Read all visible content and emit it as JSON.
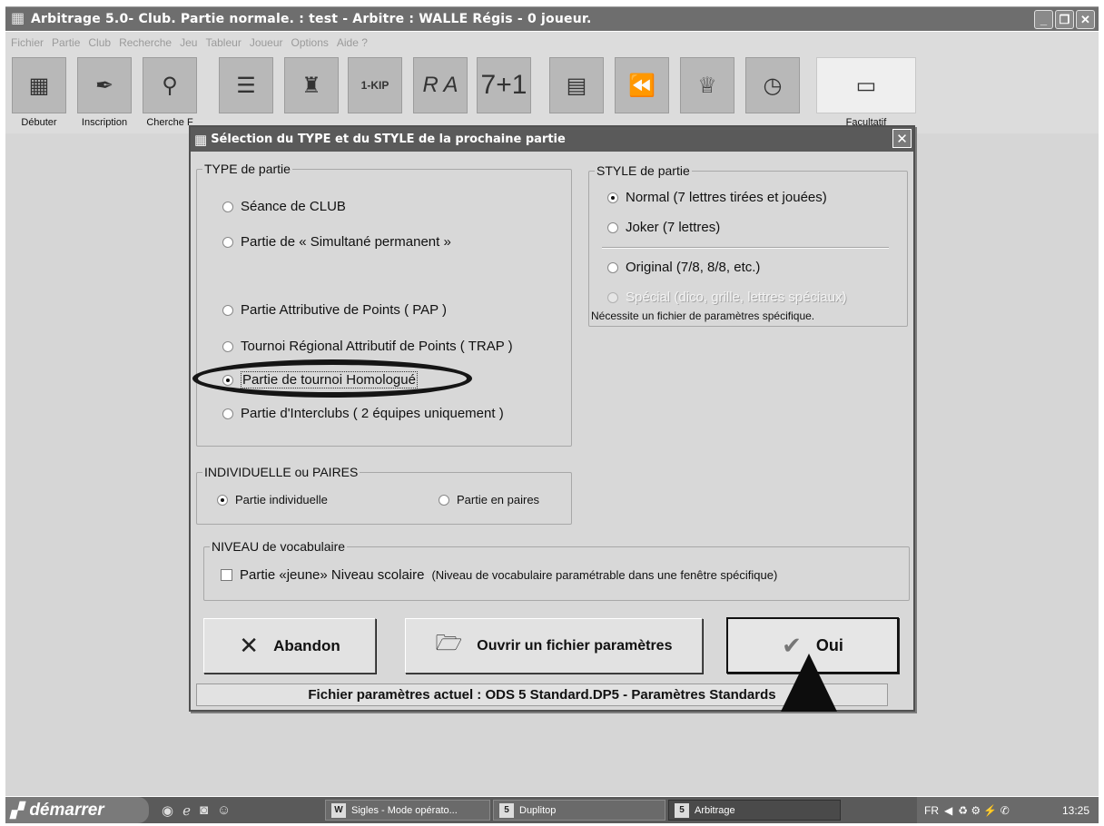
{
  "window": {
    "title": "Arbitrage 5.0- Club. Partie normale. : test - Arbitre : WALLE Régis - 0 joueur.",
    "buttons": [
      "_",
      "❐",
      "✕"
    ]
  },
  "menu": [
    "Fichier",
    "Partie",
    "Club",
    "Recherche",
    "Jeu",
    "Tableur",
    "Joueur",
    "Options",
    "Aide ?"
  ],
  "toolbar": {
    "items": [
      {
        "label": "Débuter",
        "icon": "board-icon"
      },
      {
        "label": "Inscription",
        "icon": "quill-icon"
      },
      {
        "label": "Cherche F",
        "icon": "magnifier-icon"
      },
      {
        "label": "",
        "icon": "document-icon"
      },
      {
        "label": "",
        "icon": "bag-icon"
      },
      {
        "label": "",
        "icon": "list-icon"
      },
      {
        "label": "",
        "icon": "letters-icon"
      },
      {
        "label": "",
        "icon": "plus-one-icon"
      },
      {
        "label": "",
        "icon": "dictionary-icon"
      },
      {
        "label": "",
        "icon": "rewind-icon"
      },
      {
        "label": "",
        "icon": "trophy-icon"
      },
      {
        "label": "",
        "icon": "clock-icon"
      },
      {
        "label": "Facultatif",
        "icon": "usb-key-icon"
      }
    ]
  },
  "dialog": {
    "title": "Sélection du TYPE et du STYLE de la prochaine partie",
    "type_group": {
      "legend": "TYPE de partie",
      "options": [
        {
          "label": "Séance de CLUB",
          "selected": false
        },
        {
          "label": "Partie de « Simultané permanent »",
          "selected": false
        },
        {
          "label": "Partie Attributive de Points ( PAP )",
          "selected": false
        },
        {
          "label": "Tournoi Régional Attributif de Points ( TRAP )",
          "selected": false
        },
        {
          "label": "Partie de tournoi Homologué",
          "selected": true
        },
        {
          "label": "Partie d'Interclubs ( 2 équipes uniquement )",
          "selected": false
        }
      ]
    },
    "style_group": {
      "legend": "STYLE de partie",
      "options": [
        {
          "label": "Normal (7 lettres tirées et jouées)",
          "selected": true
        },
        {
          "label": "Joker (7 lettres)",
          "selected": false
        },
        {
          "label": "Original (7/8, 8/8, etc.)",
          "selected": false
        },
        {
          "label": "Spécial (dico, grille, lettres spéciaux)",
          "selected": false,
          "disabled": true
        }
      ],
      "note": "Nécessite un fichier de paramètres spécifique."
    },
    "mode_group": {
      "legend": "INDIVIDUELLE ou PAIRES",
      "options": [
        {
          "label": "Partie individuelle",
          "selected": true
        },
        {
          "label": "Partie en paires",
          "selected": false
        }
      ]
    },
    "level_group": {
      "legend": "NIVEAU de vocabulaire",
      "checkbox_label": "Partie «jeune» Niveau scolaire",
      "checkbox_note": "(Niveau de vocabulaire paramétrable dans une fenêtre spécifique)",
      "checked": false
    },
    "buttons": {
      "cancel": "Abandon",
      "open": "Ouvrir un fichier paramètres",
      "ok": "Oui"
    },
    "status": "Fichier paramètres actuel : ODS 5 Standard.DP5 - Paramètres Standards"
  },
  "taskbar": {
    "start": "démarrer",
    "tasks": [
      {
        "label": "Sigles - Mode opérato...",
        "icon": "W"
      },
      {
        "label": "Duplitop",
        "icon": "5"
      },
      {
        "label": "Arbitrage",
        "icon": "5",
        "active": true
      }
    ],
    "tray": {
      "lang": "FR",
      "clock": "13:25"
    }
  }
}
